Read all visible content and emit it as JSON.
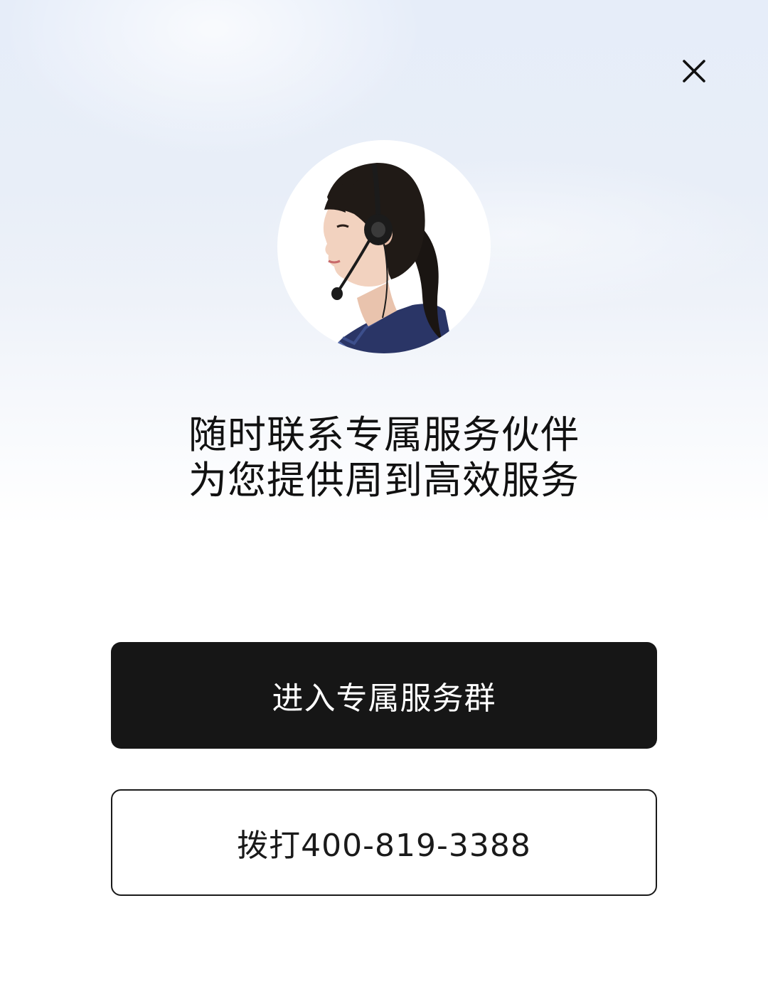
{
  "dialog": {
    "close_icon": "close-icon",
    "avatar_icon": "customer-service-agent-portrait"
  },
  "headline": {
    "line1": "随时联系专属服务伙伴",
    "line2": "为您提供周到高效服务"
  },
  "actions": {
    "primary_label": "进入专属服务群",
    "secondary_label": "拨打400-819-3388"
  },
  "colors": {
    "primary_button_bg": "#161616",
    "primary_button_text": "#ffffff",
    "secondary_button_border": "#1a1a1a",
    "uniform_navy": "#2a3566"
  }
}
